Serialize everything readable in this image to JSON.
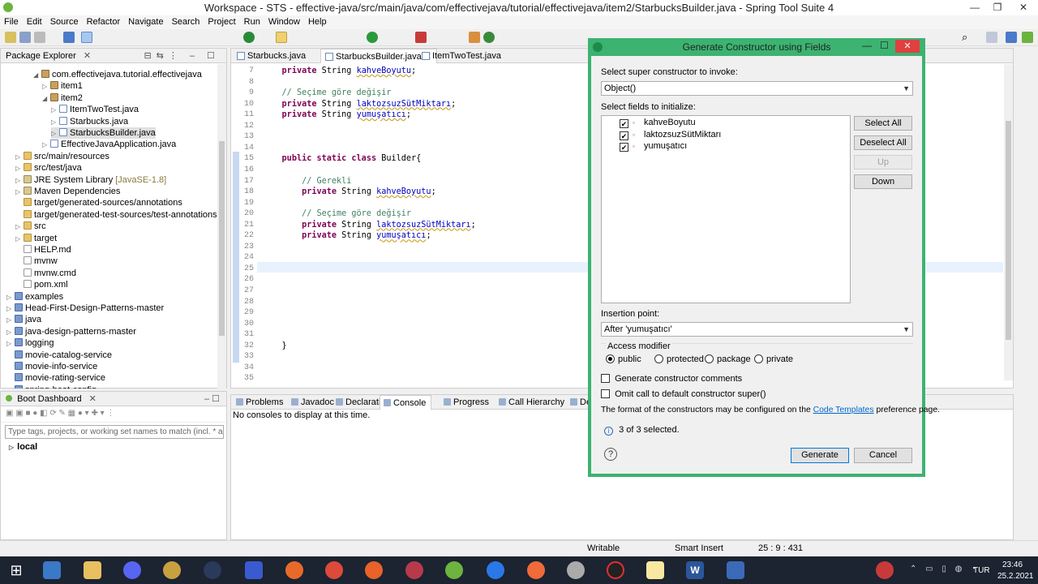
{
  "window": {
    "title": "Workspace - STS - effective-java/src/main/java/com/effectivejava/tutorial/effectivejava/item2/StarbucksBuilder.java - Spring Tool Suite 4"
  },
  "menu": [
    "File",
    "Edit",
    "Source",
    "Refactor",
    "Navigate",
    "Search",
    "Project",
    "Run",
    "Window",
    "Help"
  ],
  "package_explorer": {
    "title": "Package Explorer",
    "items": [
      {
        "label": "com.effectivejava.tutorial.effectivejava",
        "indent": 4,
        "icon": "pkg",
        "arrow": "◢"
      },
      {
        "label": "item1",
        "indent": 5,
        "icon": "pkg",
        "arrow": "▷"
      },
      {
        "label": "item2",
        "indent": 5,
        "icon": "pkg",
        "arrow": "◢"
      },
      {
        "label": "ItemTwoTest.java",
        "indent": 6,
        "icon": "java",
        "arrow": "▷"
      },
      {
        "label": "Starbucks.java",
        "indent": 6,
        "icon": "java",
        "arrow": "▷"
      },
      {
        "label": "StarbucksBuilder.java",
        "indent": 6,
        "icon": "java",
        "arrow": "▷",
        "selected": true
      },
      {
        "label": "EffectiveJavaApplication.java",
        "indent": 5,
        "icon": "java",
        "arrow": "▷"
      },
      {
        "label": "src/main/resources",
        "indent": 2,
        "icon": "folder",
        "arrow": "▷"
      },
      {
        "label": "src/test/java",
        "indent": 2,
        "icon": "folder",
        "arrow": "▷"
      },
      {
        "label": "JRE System Library",
        "suffix": "[JavaSE-1.8]",
        "indent": 2,
        "icon": "lib",
        "arrow": "▷"
      },
      {
        "label": "Maven Dependencies",
        "indent": 2,
        "icon": "lib",
        "arrow": "▷"
      },
      {
        "label": "target/generated-sources/annotations",
        "indent": 2,
        "icon": "folder",
        "arrow": ""
      },
      {
        "label": "target/generated-test-sources/test-annotations",
        "indent": 2,
        "icon": "folder",
        "arrow": ""
      },
      {
        "label": "src",
        "indent": 2,
        "icon": "folder",
        "arrow": "▷"
      },
      {
        "label": "target",
        "indent": 2,
        "icon": "folder",
        "arrow": "▷"
      },
      {
        "label": "HELP.md",
        "indent": 2,
        "icon": "file",
        "arrow": ""
      },
      {
        "label": "mvnw",
        "indent": 2,
        "icon": "file",
        "arrow": ""
      },
      {
        "label": "mvnw.cmd",
        "indent": 2,
        "icon": "file",
        "arrow": ""
      },
      {
        "label": "pom.xml",
        "indent": 2,
        "icon": "file",
        "arrow": ""
      },
      {
        "label": "examples",
        "indent": 1,
        "icon": "proj",
        "arrow": "▷"
      },
      {
        "label": "Head-First-Design-Patterns-master",
        "indent": 1,
        "icon": "proj",
        "arrow": "▷"
      },
      {
        "label": "java",
        "indent": 1,
        "icon": "proj",
        "arrow": "▷"
      },
      {
        "label": "java-design-patterns-master",
        "indent": 1,
        "icon": "proj",
        "arrow": "▷"
      },
      {
        "label": "logging",
        "indent": 1,
        "icon": "proj",
        "arrow": "▷"
      },
      {
        "label": "movie-catalog-service",
        "indent": 1,
        "icon": "proj",
        "arrow": ""
      },
      {
        "label": "movie-info-service",
        "indent": 1,
        "icon": "proj",
        "arrow": ""
      },
      {
        "label": "movie-rating-service",
        "indent": 1,
        "icon": "proj",
        "arrow": ""
      },
      {
        "label": "spring-boot-config",
        "indent": 1,
        "icon": "proj",
        "arrow": ""
      }
    ]
  },
  "boot_dashboard": {
    "title": "Boot Dashboard",
    "filter_placeholder": "Type tags, projects, or working set names to match (incl. * and",
    "items": [
      "local"
    ]
  },
  "editor": {
    "tabs": [
      "Starbucks.java",
      "StarbucksBuilder.java",
      "ItemTwoTest.java"
    ],
    "active_tab": 1,
    "lines": [
      {
        "n": "7",
        "html": "    <span class='kw'>private</span> String <span class='fld'>kahveBoyutu</span>;"
      },
      {
        "n": "8",
        "html": ""
      },
      {
        "n": "9",
        "html": "    <span class='cm'>// Seçime göre değişir</span>"
      },
      {
        "n": "10",
        "html": "    <span class='kw'>private</span> String <span class='fld'>laktozsuzSütMiktarı</span>;"
      },
      {
        "n": "11",
        "html": "    <span class='kw'>private</span> String <span class='fld'>yumuşatıcı</span>;"
      },
      {
        "n": "12",
        "html": ""
      },
      {
        "n": "13",
        "html": ""
      },
      {
        "n": "14",
        "html": ""
      },
      {
        "n": "15",
        "html": "    <span class='kw'>public static class</span> Builder{"
      },
      {
        "n": "16",
        "html": ""
      },
      {
        "n": "17",
        "html": "        <span class='cm'>// Gerekli</span>"
      },
      {
        "n": "18",
        "html": "        <span class='kw'>private</span> String <span class='fld'>kahveBoyutu</span>;"
      },
      {
        "n": "19",
        "html": ""
      },
      {
        "n": "20",
        "html": "        <span class='cm'>// Seçime göre değişir</span>"
      },
      {
        "n": "21",
        "html": "        <span class='kw'>private</span> String <span class='fld'>laktozsuzSütMiktarı</span>;"
      },
      {
        "n": "22",
        "html": "        <span class='kw'>private</span> String <span class='fld'>yumuşatıcı</span>;"
      },
      {
        "n": "23",
        "html": ""
      },
      {
        "n": "24",
        "html": ""
      },
      {
        "n": "25",
        "html": ""
      },
      {
        "n": "26",
        "html": ""
      },
      {
        "n": "27",
        "html": ""
      },
      {
        "n": "28",
        "html": ""
      },
      {
        "n": "29",
        "html": ""
      },
      {
        "n": "30",
        "html": ""
      },
      {
        "n": "31",
        "html": ""
      },
      {
        "n": "32",
        "html": "    }"
      },
      {
        "n": "33",
        "html": ""
      },
      {
        "n": "34",
        "html": ""
      },
      {
        "n": "35",
        "html": ""
      }
    ]
  },
  "console": {
    "tabs": [
      "Problems",
      "Javadoc",
      "Declaration",
      "Console",
      "Progress",
      "Call Hierarchy",
      "Del"
    ],
    "message": "No consoles to display at this time."
  },
  "status": {
    "writable": "Writable",
    "insert_mode": "Smart Insert",
    "position": "25 : 9 : 431"
  },
  "taskbar": {
    "lang": "TUR",
    "time": "23:46",
    "date": "25.2.2021"
  },
  "dialog": {
    "title": "Generate Constructor using Fields",
    "super_label": "Select super constructor to invoke:",
    "super_value": "Object()",
    "fields_label": "Select fields to initialize:",
    "fields": [
      {
        "name": "kahveBoyutu",
        "checked": true
      },
      {
        "name": "laktozsuzSütMiktarı",
        "checked": true
      },
      {
        "name": "yumuşatıcı",
        "checked": true
      }
    ],
    "buttons": {
      "select_all": "Select All",
      "deselect_all": "Deselect All",
      "up": "Up",
      "down": "Down"
    },
    "insertion_label": "Insertion point:",
    "insertion_value": "After 'yumuşatıcı'",
    "access_label": "Access modifier",
    "access_options": [
      "public",
      "protected",
      "package",
      "private"
    ],
    "access_selected": "public",
    "gen_comments": "Generate constructor comments",
    "omit_super": "Omit call to default constructor super()",
    "format_prefix": "The format of the constructors may be configured on the",
    "format_link": "Code Templates",
    "format_suffix": "preference page.",
    "selection_info": "3 of 3 selected.",
    "generate": "Generate",
    "cancel": "Cancel"
  }
}
